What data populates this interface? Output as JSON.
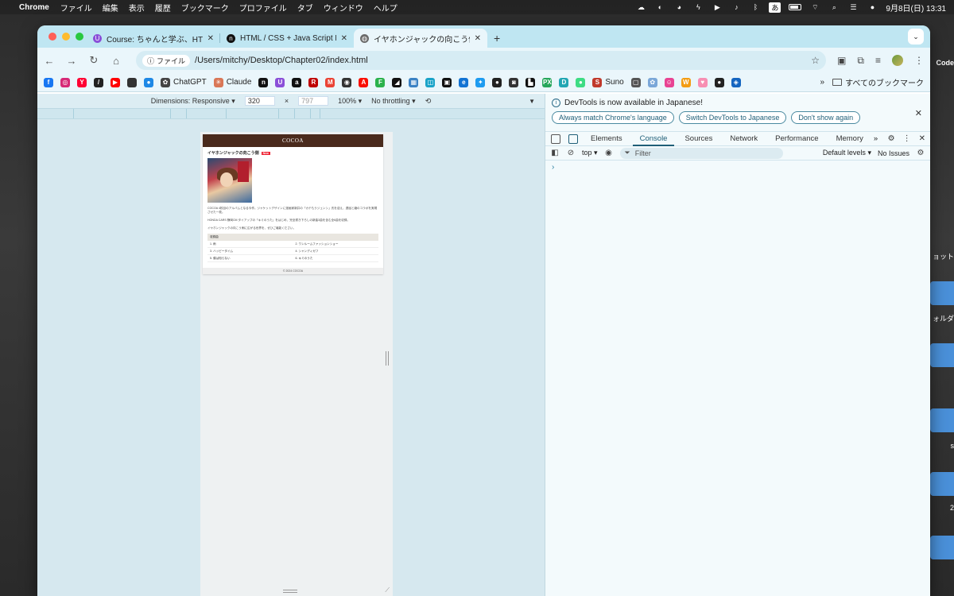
{
  "menubar": {
    "app": "Chrome",
    "items": [
      "ファイル",
      "編集",
      "表示",
      "履歴",
      "ブックマーク",
      "プロファイル",
      "タブ",
      "ウィンドウ",
      "ヘルプ"
    ],
    "ime": "あ",
    "datetime": "9月8日(日)  13:31"
  },
  "desktop": {
    "labels": [
      "Code",
      "ョット",
      "ォルダ",
      "s",
      "2"
    ]
  },
  "tabs": [
    {
      "title": "Course: ちゃんと学ぶ、HTML/CSS",
      "favicon_color": "#8a4fd8"
    },
    {
      "title": "HTML / CSS + Java Script Note",
      "favicon_color": "#111111"
    },
    {
      "title": "イヤホンジャックの向こう側",
      "favicon_color": "#6b6b6b",
      "active": true
    }
  ],
  "toolbar": {
    "chip": "ファイル",
    "url": "/Users/mitchy/Desktop/Chapter02/index.html"
  },
  "bookmarks": [
    {
      "label": "",
      "icon": "facebook-icon",
      "color": "#1877f2",
      "glyph": "f"
    },
    {
      "label": "",
      "icon": "instagram-icon",
      "color": "#d62976",
      "glyph": "◎"
    },
    {
      "label": "",
      "icon": "yahoo-icon",
      "color": "#ff0033",
      "glyph": "Y"
    },
    {
      "label": "",
      "icon": "slash-icon",
      "color": "#222222",
      "glyph": "/"
    },
    {
      "label": "",
      "icon": "youtube-icon",
      "color": "#ff0000",
      "glyph": "▶"
    },
    {
      "label": "",
      "icon": "apple-icon",
      "color": "#333333",
      "glyph": ""
    },
    {
      "label": "",
      "icon": "app-icon",
      "color": "#1e88e5",
      "glyph": "●"
    },
    {
      "label": "ChatGPT",
      "icon": "chatgpt-icon",
      "color": "#444444",
      "glyph": "✿"
    },
    {
      "label": "Claude",
      "icon": "claude-icon",
      "color": "#d97757",
      "glyph": "✳"
    },
    {
      "label": "",
      "icon": "note-icon",
      "color": "#111111",
      "glyph": "n"
    },
    {
      "label": "",
      "icon": "udemy-icon",
      "color": "#8a4fd8",
      "glyph": "U"
    },
    {
      "label": "",
      "icon": "amazon-icon",
      "color": "#111111",
      "glyph": "a"
    },
    {
      "label": "",
      "icon": "rakuten-icon",
      "color": "#bf0000",
      "glyph": "R"
    },
    {
      "label": "",
      "icon": "gmail-icon",
      "color": "#ea4335",
      "glyph": "M"
    },
    {
      "label": "",
      "icon": "bookmark-app-icon",
      "color": "#333333",
      "glyph": "◉"
    },
    {
      "label": "",
      "icon": "adobe-icon",
      "color": "#fa0f00",
      "glyph": "A"
    },
    {
      "label": "",
      "icon": "feedly-icon",
      "color": "#2bb24c",
      "glyph": "F"
    },
    {
      "label": "",
      "icon": "zenn-icon",
      "color": "#111111",
      "glyph": "◢"
    },
    {
      "label": "",
      "icon": "mosaic-icon",
      "color": "#3b82c4",
      "glyph": "▦"
    },
    {
      "label": "",
      "icon": "tool-icon",
      "color": "#1aa3c8",
      "glyph": "◫"
    },
    {
      "label": "",
      "icon": "qr-icon",
      "color": "#111111",
      "glyph": "▣"
    },
    {
      "label": "",
      "icon": "edge-icon",
      "color": "#1273d3",
      "glyph": "e"
    },
    {
      "label": "",
      "icon": "twitter-icon",
      "color": "#1d9bf0",
      "glyph": "✦"
    },
    {
      "label": "",
      "icon": "github-icon",
      "color": "#222222",
      "glyph": "●"
    },
    {
      "label": "",
      "icon": "camera-icon",
      "color": "#333333",
      "glyph": "◙"
    },
    {
      "label": "",
      "icon": "bucket-icon",
      "color": "#111111",
      "glyph": "▙"
    },
    {
      "label": "",
      "icon": "px-icon",
      "color": "#26a65b",
      "glyph": "PX"
    },
    {
      "label": "",
      "icon": "d-icon",
      "color": "#22a6b3",
      "glyph": "D"
    },
    {
      "label": "",
      "icon": "android-icon",
      "color": "#3ddc84",
      "glyph": "●"
    },
    {
      "label": "Suno",
      "icon": "suno-icon",
      "color": "#c0392b",
      "glyph": "S"
    },
    {
      "label": "",
      "icon": "app-square-icon",
      "color": "#555555",
      "glyph": "▢"
    },
    {
      "label": "",
      "icon": "gear-site-icon",
      "color": "#7aa7d8",
      "glyph": "✿"
    },
    {
      "label": "",
      "icon": "smile-icon",
      "color": "#e84393",
      "glyph": "☺"
    },
    {
      "label": "",
      "icon": "w-icon",
      "color": "#f39c12",
      "glyph": "W"
    },
    {
      "label": "",
      "icon": "heart-icon",
      "color": "#f78fb3",
      "glyph": "♥"
    },
    {
      "label": "",
      "icon": "globe-icon",
      "color": "#222222",
      "glyph": "●"
    },
    {
      "label": "",
      "icon": "flame-icon",
      "color": "#1565c0",
      "glyph": "◈"
    }
  ],
  "bookmarks_folder": "すべてのブックマーク",
  "device_toolbar": {
    "dimensions": "Dimensions: Responsive",
    "width": "320",
    "height": "797",
    "zoom": "100%",
    "throttling": "No throttling"
  },
  "page": {
    "header": "COCOA",
    "album_title": "イヤホンジャックの向こう側",
    "badge": "New",
    "paragraphs": [
      "COCOA 4枚目のアルバムとなる今作。ジャケットデザインに漫画家新井の「カテもうジェンシ」氏を迎え、退屈と縮のコラボを実現させた一枚。",
      "HONDA CARS 静岡CM タイアップの「キミのうた」をはじめ、完全書き下ろしの新曲3曲を含む全6曲を収録。",
      "イヤホンジャックの向こう側に広がる世界を、ぜひご堪能ください。"
    ],
    "tracklist_title": "収録曲",
    "tracks": [
      "1. 雨",
      "2. ワンルームファッションショー",
      "3. ハッピータイム",
      "4. シャンディガフ",
      "5. 僕は知らない",
      "6. キミのうた"
    ],
    "footer": "© 2024 COCOA"
  },
  "devtools": {
    "info_message": "DevTools is now available in Japanese!",
    "buttons": [
      "Always match Chrome's language",
      "Switch DevTools to Japanese",
      "Don't show again"
    ],
    "tabs": [
      "Elements",
      "Console",
      "Sources",
      "Network",
      "Performance",
      "Memory"
    ],
    "active_tab": "Console",
    "context": "top",
    "filter_placeholder": "Filter",
    "levels": "Default levels",
    "issues": "No Issues",
    "prompt": "›"
  }
}
